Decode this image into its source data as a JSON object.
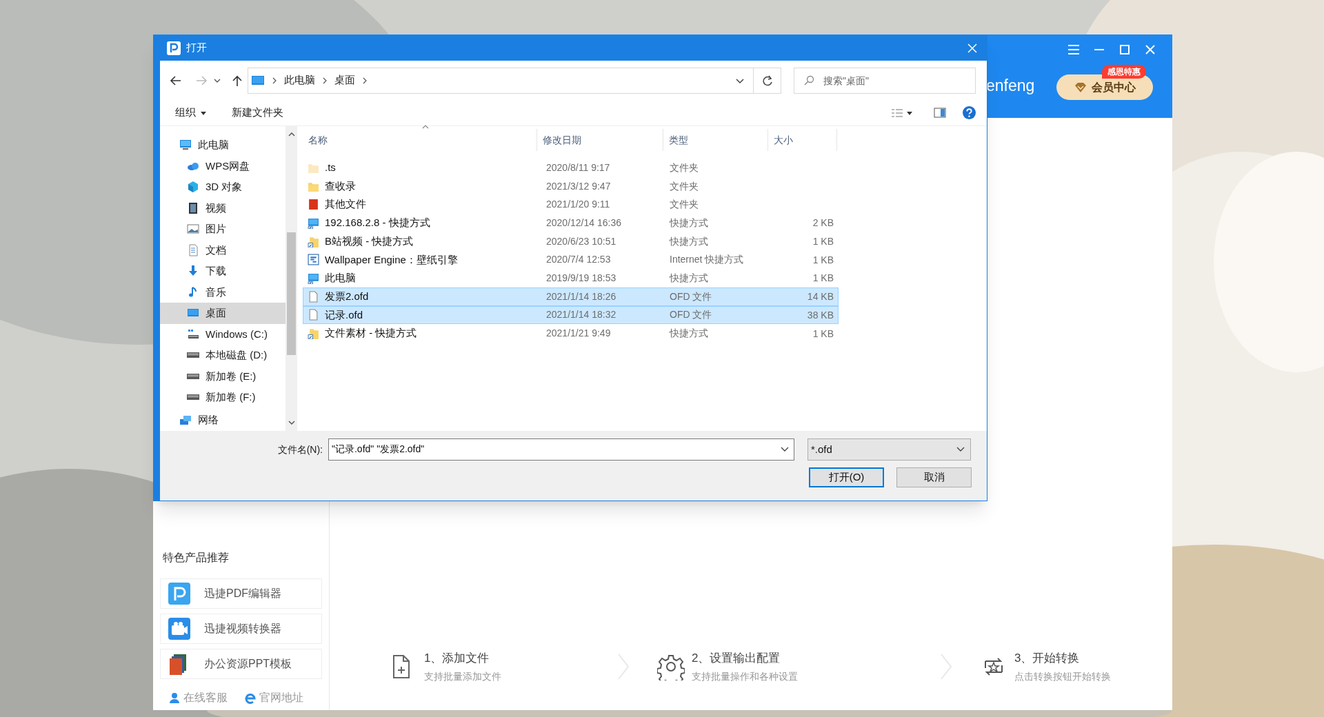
{
  "app": {
    "header_text": "enfeng",
    "vip_badge": "感恩特惠",
    "vip_button": "会员中心"
  },
  "sidebar": {
    "heading": "特色产品推荐",
    "products": [
      {
        "label": "迅捷PDF编辑器",
        "kind": "pdf"
      },
      {
        "label": "迅捷视频转换器",
        "kind": "video"
      },
      {
        "label": "办公资源PPT模板",
        "kind": "ppt"
      }
    ],
    "links": [
      {
        "label": "在线客服",
        "kind": "service"
      },
      {
        "label": "官网地址",
        "kind": "web"
      }
    ]
  },
  "steps": [
    {
      "title": "1、添加文件",
      "subtitle": "支持批量添加文件",
      "kind": "add"
    },
    {
      "title": "2、设置输出配置",
      "subtitle": "支持批量操作和各种设置",
      "kind": "settings"
    },
    {
      "title": "3、开始转换",
      "subtitle": "点击转换按钮开始转换",
      "kind": "convert"
    }
  ],
  "dialog": {
    "title": "打开",
    "breadcrumb": [
      "此电脑",
      "桌面"
    ],
    "search": {
      "placeholder": "搜索\"桌面\""
    },
    "commands": [
      {
        "label": "组织",
        "dropdown": true
      },
      {
        "label": "新建文件夹",
        "dropdown": false
      }
    ],
    "nav": [
      {
        "label": "此电脑",
        "kind": "pc",
        "selected": false,
        "children": [
          {
            "label": "WPS网盘",
            "kind": "cloud",
            "selected": false
          },
          {
            "label": "3D 对象",
            "kind": "cube",
            "selected": false
          },
          {
            "label": "视频",
            "kind": "video",
            "selected": false
          },
          {
            "label": "图片",
            "kind": "picture",
            "selected": false
          },
          {
            "label": "文档",
            "kind": "document",
            "selected": false
          },
          {
            "label": "下载",
            "kind": "download",
            "selected": false
          },
          {
            "label": "音乐",
            "kind": "music",
            "selected": false
          },
          {
            "label": "桌面",
            "kind": "desktop",
            "selected": true
          },
          {
            "label": "Windows (C:)",
            "kind": "system_drive",
            "selected": false
          },
          {
            "label": "本地磁盘 (D:)",
            "kind": "drive",
            "selected": false
          },
          {
            "label": "新加卷 (E:)",
            "kind": "drive",
            "selected": false
          },
          {
            "label": "新加卷 (F:)",
            "kind": "drive",
            "selected": false
          }
        ]
      },
      {
        "label": "网络",
        "kind": "network",
        "selected": false
      }
    ],
    "columns": [
      "名称",
      "修改日期",
      "类型",
      "大小"
    ],
    "rows": [
      {
        "name": ".ts",
        "date": "2020/8/11 9:17",
        "type": "文件夹",
        "kind": "hidden_folder",
        "selected": false
      },
      {
        "name": "查收录",
        "date": "2021/3/12 9:47",
        "type": "文件夹",
        "kind": "folder",
        "selected": false
      },
      {
        "name": "其他文件",
        "date": "2021/1/20 9:11",
        "type": "文件夹",
        "kind": "red_folder",
        "selected": false
      },
      {
        "name": "192.168.2.8 - 快捷方式",
        "date": "2020/12/14 16:36",
        "type": "快捷方式",
        "size": "2 KB",
        "kind": "pc_shortcut",
        "selected": false
      },
      {
        "name": "B站视频 - 快捷方式",
        "date": "2020/6/23 10:51",
        "type": "快捷方式",
        "size": "1 KB",
        "kind": "folder_shortcut",
        "selected": false
      },
      {
        "name": "Wallpaper Engine：壁纸引擎",
        "date": "2020/7/4 12:53",
        "type": "Internet 快捷方式",
        "size": "1 KB",
        "kind": "url_shortcut",
        "selected": false
      },
      {
        "name": "此电脑",
        "date": "2019/9/19 18:53",
        "type": "快捷方式",
        "size": "1 KB",
        "kind": "pc_shortcut",
        "selected": false
      },
      {
        "name": "发票2.ofd",
        "date": "2021/1/14 18:26",
        "type": "OFD 文件",
        "size": "14 KB",
        "kind": "file",
        "selected": true
      },
      {
        "name": "记录.ofd",
        "date": "2021/1/14 18:32",
        "type": "OFD 文件",
        "size": "38 KB",
        "kind": "file",
        "selected": true
      },
      {
        "name": "文件素材 - 快捷方式",
        "date": "2021/1/21 9:49",
        "type": "快捷方式",
        "size": "1 KB",
        "kind": "folder_shortcut",
        "selected": false
      }
    ],
    "filename": {
      "label": "文件名(N):",
      "value": "\"记录.ofd\" \"发票2.ofd\""
    },
    "filter": "*.ofd",
    "buttons": [
      {
        "label": "打开(O)",
        "default": true
      },
      {
        "label": "取消",
        "default": false
      }
    ]
  }
}
